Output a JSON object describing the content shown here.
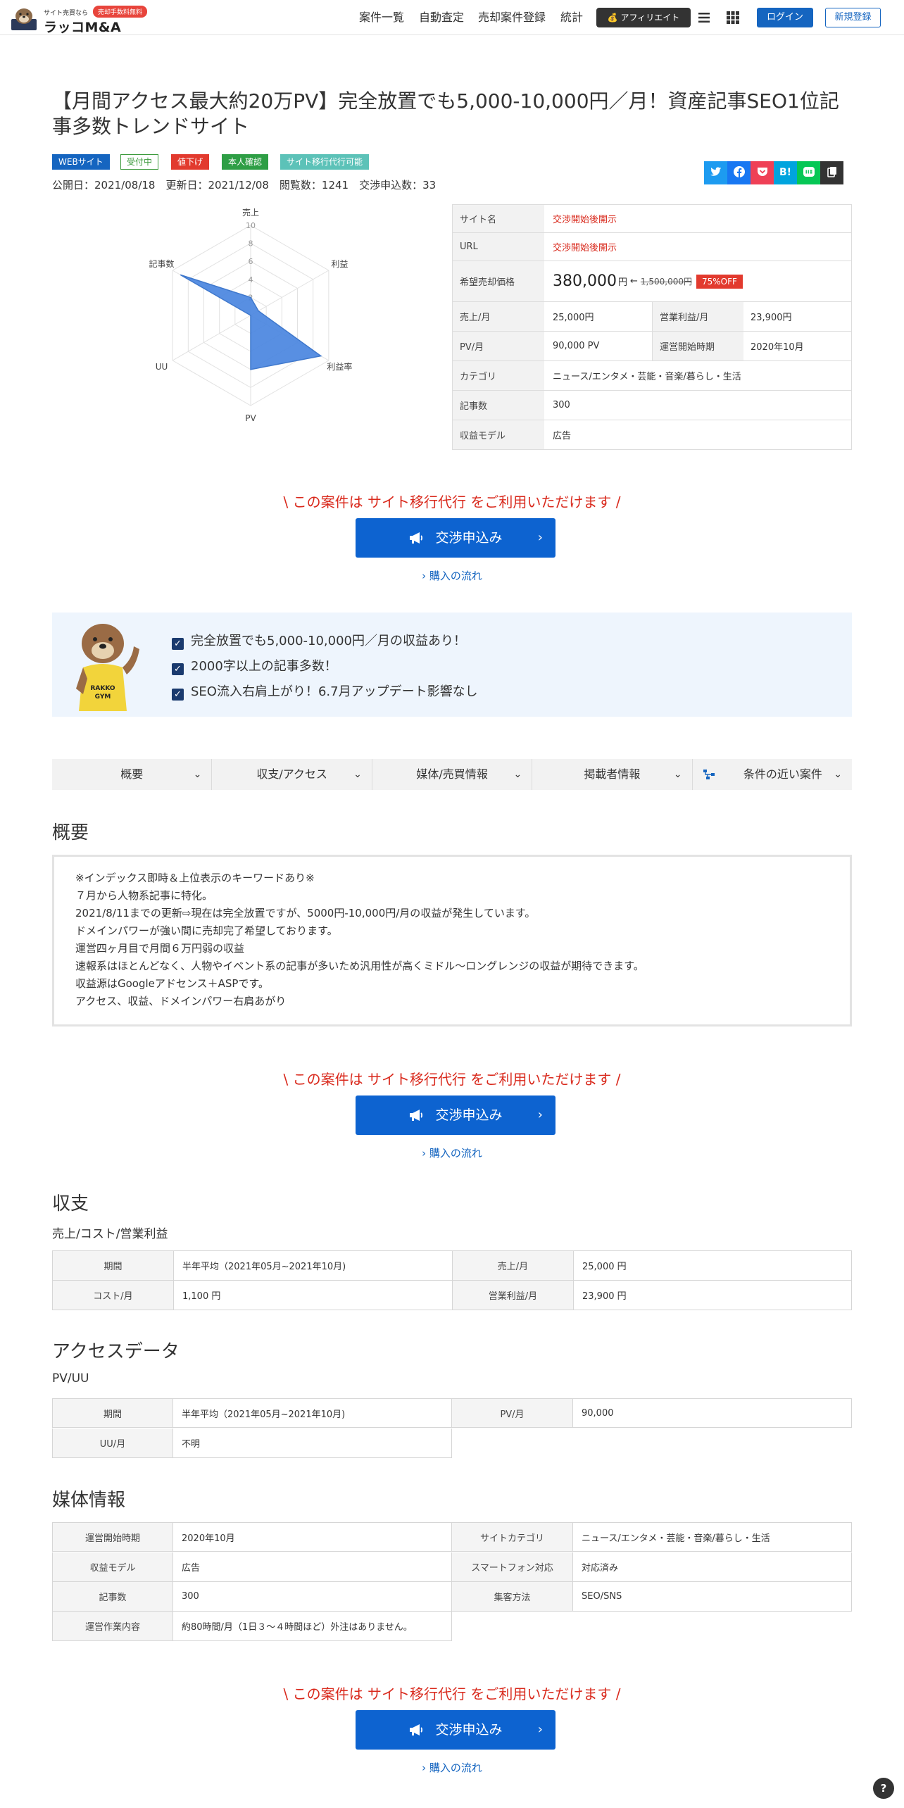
{
  "header": {
    "logo_small": "サイト売買なら",
    "logo_badge": "売却手数料無料",
    "logo_main": "ラッコM&A",
    "nav": [
      "案件一覧",
      "自動査定",
      "売却案件登録",
      "統計"
    ],
    "affiliate": "アフィリエイト",
    "login": "ログイン",
    "signup": "新規登録"
  },
  "listing": {
    "title": "【月間アクセス最大約20万PV】完全放置でも5,000-10,000円／月！資産記事SEO1位記事多数トレンドサイト",
    "tags": [
      "WEBサイト",
      "受付中",
      "値下げ",
      "本人確認",
      "サイト移行代行可能"
    ],
    "meta": "公開日：2021/08/18　更新日：2021/12/08　閲覧数：1241　交渉申込数：33",
    "share_hatena": "B!"
  },
  "radar": {
    "axes": [
      "売上",
      "利益",
      "利益率",
      "PV",
      "UU",
      "記事数"
    ],
    "ticks": [
      "2",
      "4",
      "6",
      "8",
      "10"
    ],
    "values": [
      2,
      1,
      9,
      6,
      0,
      9
    ],
    "max": 10,
    "color": "#4a86df"
  },
  "info": {
    "site_name_label": "サイト名",
    "site_name": "交渉開始後開示",
    "url_label": "URL",
    "url": "交渉開始後開示",
    "price_label": "希望売却価格",
    "price": "380,000",
    "price_unit": "円",
    "arrow": "←",
    "old_price": "1,500,000円",
    "discount": "75%OFF",
    "sales_label": "売上/月",
    "sales": "25,000円",
    "profit_label": "営業利益/月",
    "profit": "23,900円",
    "pv_label": "PV/月",
    "pv": "90,000 PV",
    "start_label": "運営開始時期",
    "start": "2020年10月",
    "category_label": "カテゴリ",
    "category": "ニュース/エンタメ・芸能・音楽/暮らし・生活",
    "articles_label": "記事数",
    "articles": "300",
    "model_label": "収益モデル",
    "model": "広告"
  },
  "cta": {
    "note": "\\ この案件は サイト移行代行 をご利用いただけます /",
    "button": "交渉申込み",
    "link": "購入の流れ"
  },
  "features": [
    "完全放置でも5,000-10,000円／月の収益あり！",
    "2000字以上の記事多数！",
    "SEO流入右肩上がり！6.7月アップデート影響なし"
  ],
  "tabs": [
    "概要",
    "収支/アクセス",
    "媒体/売買情報",
    "掲載者情報",
    "条件の近い案件"
  ],
  "overview": {
    "title": "概要",
    "lines": [
      "※インデックス即時＆上位表示のキーワードあり※",
      "７月から人物系記事に特化。",
      "2021/8/11までの更新⇨現在は完全放置ですが、5000円-10,000円/月の収益が発生しています。",
      "ドメインパワーが強い間に売却完了希望しております。",
      "運営四ヶ月目で月間６万円弱の収益",
      "速報系はほとんどなく、人物やイベント系の記事が多いため汎用性が高くミドル〜ロングレンジの収益が期待できます。",
      "収益源はGoogleアドセンス＋ASPです。",
      "アクセス、収益、ドメインパワー右肩あがり"
    ]
  },
  "income": {
    "title": "収支",
    "sub": "売上/コスト/営業利益",
    "period_label": "期間",
    "period": "半年平均（2021年05月~2021年10月)",
    "sales_label": "売上/月",
    "sales": "25,000 円",
    "cost_label": "コスト/月",
    "cost": "1,100 円",
    "profit_label": "営業利益/月",
    "profit": "23,900 円"
  },
  "access": {
    "title": "アクセスデータ",
    "sub": "PV/UU",
    "period_label": "期間",
    "period": "半年平均（2021年05月~2021年10月)",
    "pv_label": "PV/月",
    "pv": "90,000",
    "uu_label": "UU/月",
    "uu": "不明"
  },
  "media": {
    "title": "媒体情報",
    "start_label": "運営開始時期",
    "start": "2020年10月",
    "cat_label": "サイトカテゴリ",
    "cat": "ニュース/エンタメ・芸能・音楽/暮らし・生活",
    "model_label": "収益モデル",
    "model": "広告",
    "sp_label": "スマートフォン対応",
    "sp": "対応済み",
    "articles_label": "記事数",
    "articles": "300",
    "traffic_label": "集客方法",
    "traffic": "SEO/SNS",
    "work_label": "運営作業内容",
    "work": "約80時間/月（1日３〜４時間ほど）外注はありません。"
  },
  "help": "?"
}
